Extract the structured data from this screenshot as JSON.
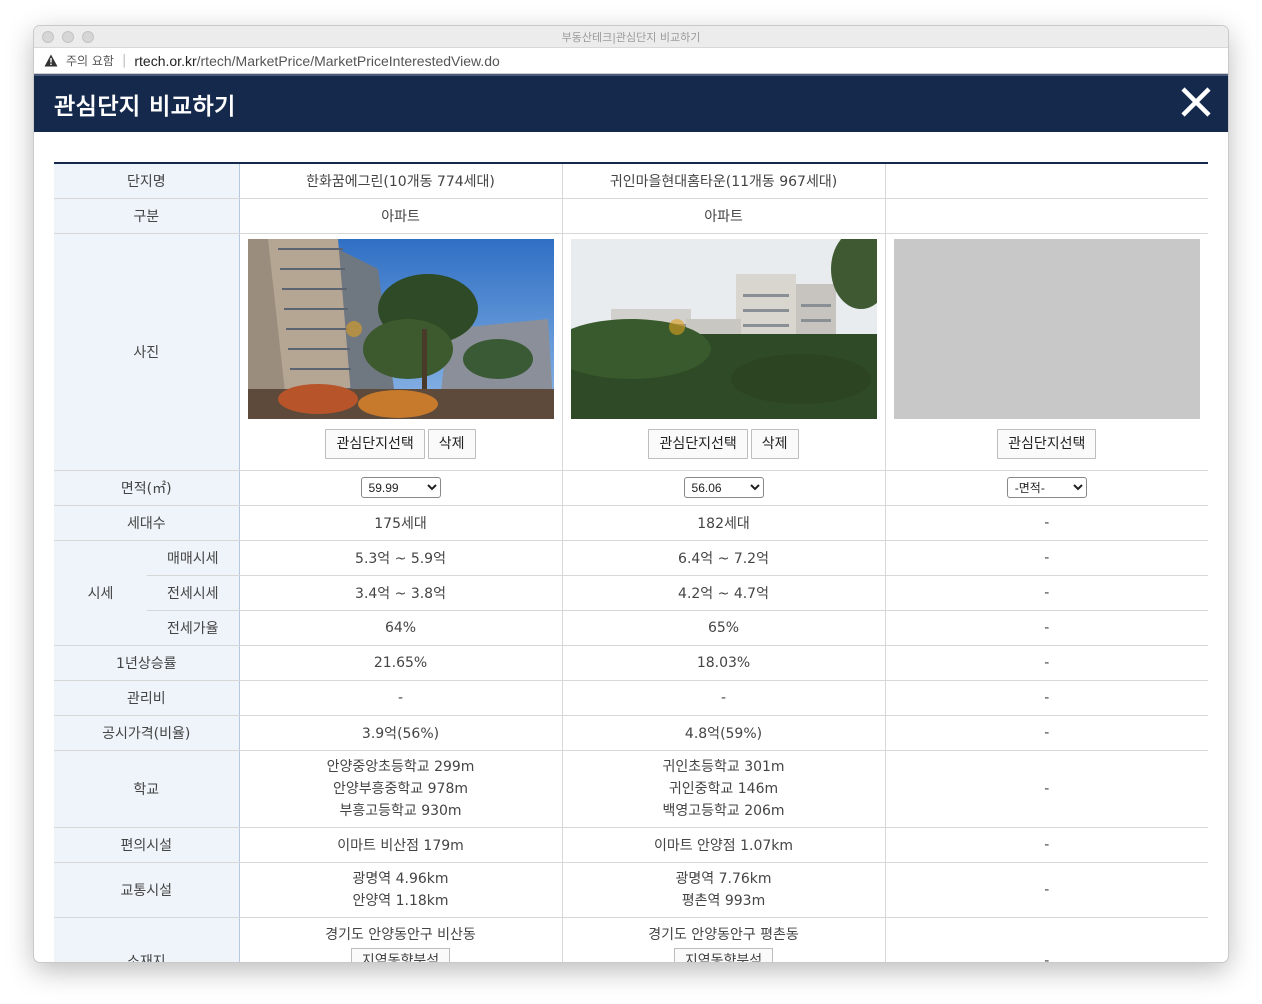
{
  "window": {
    "title": "부동산테크|관심단지 비교하기"
  },
  "address": {
    "warning": "주의 요함",
    "host": "rtech.or.kr",
    "path": "/rtech/MarketPrice/MarketPriceInterestedView.do"
  },
  "header": {
    "title": "관심단지 비교하기"
  },
  "labels": {
    "name": "단지명",
    "type": "구분",
    "photo": "사진",
    "area": "면적(㎡)",
    "households": "세대수",
    "price": "시세",
    "sale": "매매시세",
    "jeonse": "전세시세",
    "ratio": "전세가율",
    "growth": "1년상승률",
    "fee": "관리비",
    "official": "공시가격(비율)",
    "school": "학교",
    "convenience": "편의시설",
    "transport": "교통시설",
    "location": "소재지"
  },
  "buttons": {
    "select": "관심단지선택",
    "delete": "삭제",
    "region": "지역동향분석"
  },
  "complexes": [
    {
      "name": "한화꿈에그린(10개동 774세대)",
      "type": "아파트",
      "area": "59.99",
      "households": "175세대",
      "sale": "5.3억 ~ 5.9억",
      "jeonse": "3.4억 ~ 3.8억",
      "ratio": "64%",
      "growth": "21.65%",
      "fee": "-",
      "official": "3.9억(56%)",
      "schools": [
        "안양중앙초등학교 299m",
        "안양부흥중학교 978m",
        "부흥고등학교 930m"
      ],
      "convenience": "이마트 비산점 179m",
      "transport": [
        "광명역 4.96km",
        "안양역 1.18km"
      ],
      "location": "경기도 안양동안구 비산동"
    },
    {
      "name": "귀인마을현대홈타운(11개동 967세대)",
      "type": "아파트",
      "area": "56.06",
      "households": "182세대",
      "sale": "6.4억 ~ 7.2억",
      "jeonse": "4.2억 ~ 4.7억",
      "ratio": "65%",
      "growth": "18.03%",
      "fee": "-",
      "official": "4.8억(59%)",
      "schools": [
        "귀인초등학교 301m",
        "귀인중학교 146m",
        "백영고등학교 206m"
      ],
      "convenience": "이마트 안양점 1.07km",
      "transport": [
        "광명역 7.76km",
        "평촌역 993m"
      ],
      "location": "경기도 안양동안구 평촌동"
    },
    {
      "area": "-면적-",
      "empty": "-"
    }
  ],
  "colors": {
    "header_bg": "#15294d",
    "label_bg": "#eef4fa"
  },
  "icons": {
    "close": "close-icon",
    "warning": "warning-icon"
  }
}
